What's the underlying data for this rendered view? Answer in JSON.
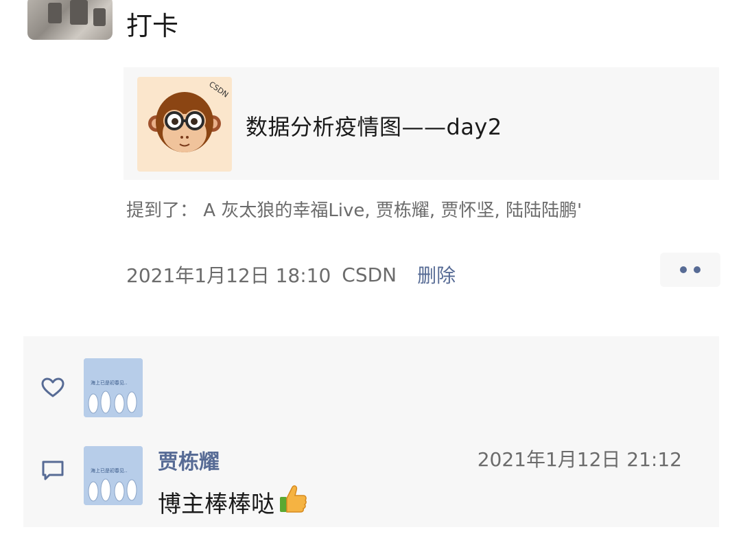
{
  "post": {
    "text": "打卡",
    "avatar_icon": "user-avatar-photo"
  },
  "link_card": {
    "title": "数据分析疫情图——day2",
    "thumbnail_icon": "csdn-monkey-icon",
    "thumbnail_badge": "CSDN"
  },
  "mention": "提到了： A 灰太狼的幸福Live, 贾栋耀, 贾怀坚, 陆陆陆鹏'",
  "meta": {
    "time": "2021年1月12日 18:10",
    "source": "CSDN",
    "delete_label": "删除",
    "more_icon": "more-dots-icon"
  },
  "likes": {
    "icon": "heart-icon",
    "avatars": [
      "liker-avatar"
    ]
  },
  "comments": [
    {
      "author": "贾栋耀",
      "time": "2021年1月12日 21:12",
      "text": "博主棒棒哒",
      "emoji_icon": "thumbs-up-icon"
    }
  ],
  "colors": {
    "link_blue": "#576b95",
    "panel_bg": "#f7f7f7",
    "text_dark": "#1a1a1a",
    "text_gray": "#6b6b6b"
  }
}
